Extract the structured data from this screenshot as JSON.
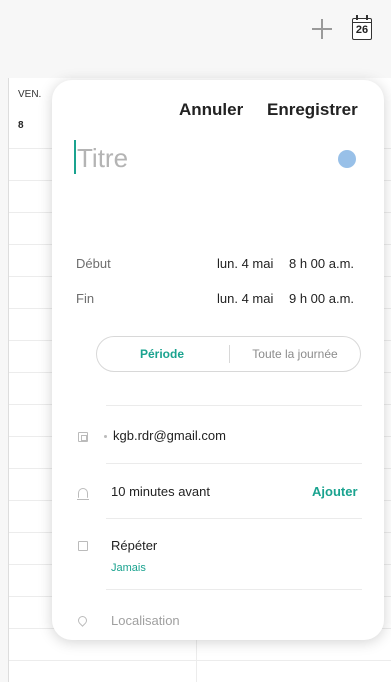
{
  "toolbar": {
    "add_icon": "plus-icon",
    "today_icon": "calendar-today-icon",
    "today_number": "26"
  },
  "background": {
    "day_name": "VEN.",
    "day_number": "8"
  },
  "card": {
    "cancel_label": "Annuler",
    "save_label": "Enregistrer",
    "title_placeholder": "Titre",
    "color": "#98c0e8",
    "start": {
      "label": "Début",
      "date": "lun. 4 mai",
      "time": "8 h 00 a.m."
    },
    "end": {
      "label": "Fin",
      "date": "lun. 4 mai",
      "time": "9 h 00 a.m."
    },
    "toggle": {
      "period": "Période",
      "all_day": "Toute la journée"
    },
    "account": "kgb.rdr@gmail.com",
    "reminder": {
      "text": "10 minutes avant",
      "add_label": "Ajouter"
    },
    "repeat": {
      "text": "Répéter",
      "value": "Jamais"
    },
    "location_placeholder": "Localisation"
  },
  "colors": {
    "accent": "#1aa38f"
  }
}
